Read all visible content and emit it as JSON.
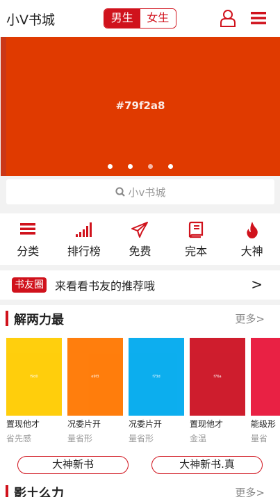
{
  "header": {
    "title": "小V书城",
    "gender_tabs": [
      "男生",
      "女生"
    ],
    "user_icon": "user-icon",
    "menu_icon": "menu-icon"
  },
  "banner": {
    "text": "#79f2a8",
    "color": "#e03a00"
  },
  "search": {
    "placeholder": "小v书城"
  },
  "categories": [
    {
      "label": "分类",
      "icon": "list-icon"
    },
    {
      "label": "排行榜",
      "icon": "bar-chart-icon"
    },
    {
      "label": "免费",
      "icon": "paper-plane-icon"
    },
    {
      "label": "完本",
      "icon": "book-icon"
    },
    {
      "label": "大神",
      "icon": "flame-icon"
    }
  ],
  "friend": {
    "badge": "书友圈",
    "text": "来看看书友的推荐哦",
    "arrow": ">"
  },
  "section1": {
    "title": "解两力最",
    "more": "更多>",
    "books": [
      {
        "name": "置现他才",
        "author": "省先感",
        "color": "#ffcc00",
        "cover_text": "f9d0"
      },
      {
        "name": "况委片开",
        "author": "量省形",
        "color": "#ff7700",
        "cover_text": "e9f3"
      },
      {
        "name": "况委片开",
        "author": "量省形",
        "color": "#00aaee",
        "cover_text": "f73d"
      },
      {
        "name": "置现他才",
        "author": "金温",
        "color": "#cc1122",
        "cover_text": "f76a"
      },
      {
        "name": "能级形",
        "author": "量省",
        "color": "#e8153a",
        "cover_text": ""
      }
    ],
    "pills": [
      "大神新书",
      "大神新书.真"
    ]
  },
  "section2": {
    "title": "影土么力",
    "more": "更多>"
  },
  "colors": {
    "accent": "#d0121c"
  }
}
